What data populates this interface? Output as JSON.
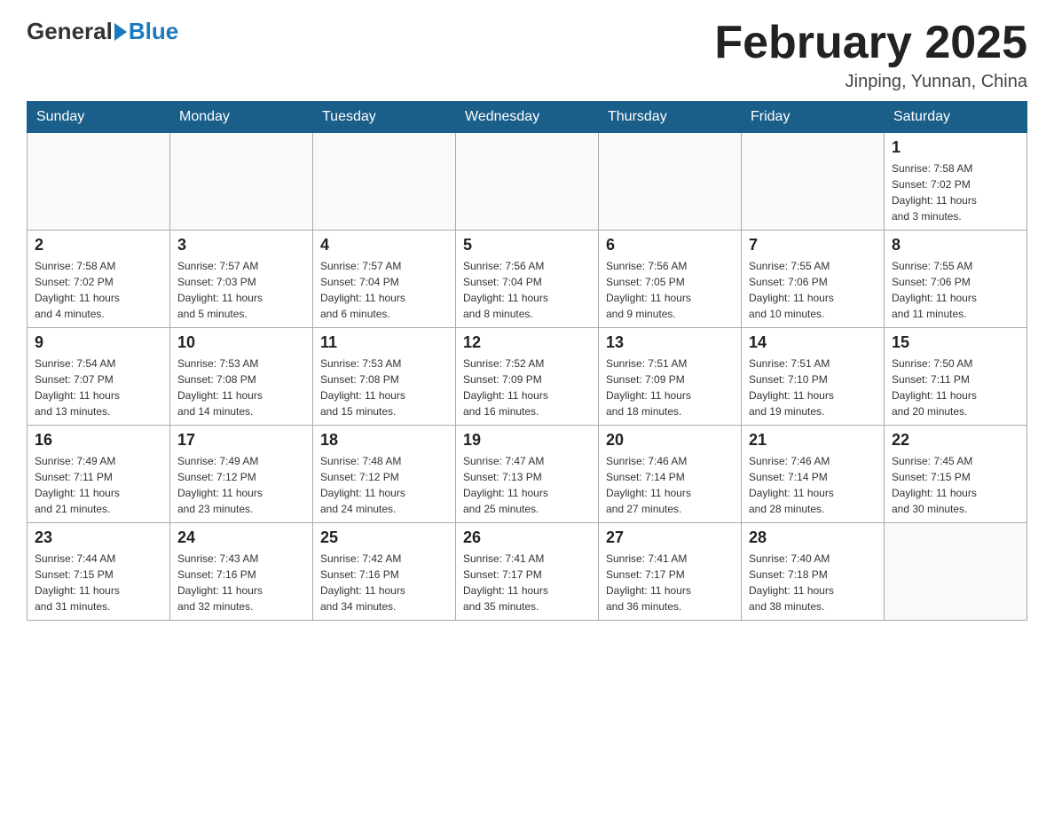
{
  "header": {
    "logo_general": "General",
    "logo_blue": "Blue",
    "month_title": "February 2025",
    "subtitle": "Jinping, Yunnan, China"
  },
  "days_of_week": [
    "Sunday",
    "Monday",
    "Tuesday",
    "Wednesday",
    "Thursday",
    "Friday",
    "Saturday"
  ],
  "weeks": [
    [
      {
        "day": "",
        "info": ""
      },
      {
        "day": "",
        "info": ""
      },
      {
        "day": "",
        "info": ""
      },
      {
        "day": "",
        "info": ""
      },
      {
        "day": "",
        "info": ""
      },
      {
        "day": "",
        "info": ""
      },
      {
        "day": "1",
        "info": "Sunrise: 7:58 AM\nSunset: 7:02 PM\nDaylight: 11 hours\nand 3 minutes."
      }
    ],
    [
      {
        "day": "2",
        "info": "Sunrise: 7:58 AM\nSunset: 7:02 PM\nDaylight: 11 hours\nand 4 minutes."
      },
      {
        "day": "3",
        "info": "Sunrise: 7:57 AM\nSunset: 7:03 PM\nDaylight: 11 hours\nand 5 minutes."
      },
      {
        "day": "4",
        "info": "Sunrise: 7:57 AM\nSunset: 7:04 PM\nDaylight: 11 hours\nand 6 minutes."
      },
      {
        "day": "5",
        "info": "Sunrise: 7:56 AM\nSunset: 7:04 PM\nDaylight: 11 hours\nand 8 minutes."
      },
      {
        "day": "6",
        "info": "Sunrise: 7:56 AM\nSunset: 7:05 PM\nDaylight: 11 hours\nand 9 minutes."
      },
      {
        "day": "7",
        "info": "Sunrise: 7:55 AM\nSunset: 7:06 PM\nDaylight: 11 hours\nand 10 minutes."
      },
      {
        "day": "8",
        "info": "Sunrise: 7:55 AM\nSunset: 7:06 PM\nDaylight: 11 hours\nand 11 minutes."
      }
    ],
    [
      {
        "day": "9",
        "info": "Sunrise: 7:54 AM\nSunset: 7:07 PM\nDaylight: 11 hours\nand 13 minutes."
      },
      {
        "day": "10",
        "info": "Sunrise: 7:53 AM\nSunset: 7:08 PM\nDaylight: 11 hours\nand 14 minutes."
      },
      {
        "day": "11",
        "info": "Sunrise: 7:53 AM\nSunset: 7:08 PM\nDaylight: 11 hours\nand 15 minutes."
      },
      {
        "day": "12",
        "info": "Sunrise: 7:52 AM\nSunset: 7:09 PM\nDaylight: 11 hours\nand 16 minutes."
      },
      {
        "day": "13",
        "info": "Sunrise: 7:51 AM\nSunset: 7:09 PM\nDaylight: 11 hours\nand 18 minutes."
      },
      {
        "day": "14",
        "info": "Sunrise: 7:51 AM\nSunset: 7:10 PM\nDaylight: 11 hours\nand 19 minutes."
      },
      {
        "day": "15",
        "info": "Sunrise: 7:50 AM\nSunset: 7:11 PM\nDaylight: 11 hours\nand 20 minutes."
      }
    ],
    [
      {
        "day": "16",
        "info": "Sunrise: 7:49 AM\nSunset: 7:11 PM\nDaylight: 11 hours\nand 21 minutes."
      },
      {
        "day": "17",
        "info": "Sunrise: 7:49 AM\nSunset: 7:12 PM\nDaylight: 11 hours\nand 23 minutes."
      },
      {
        "day": "18",
        "info": "Sunrise: 7:48 AM\nSunset: 7:12 PM\nDaylight: 11 hours\nand 24 minutes."
      },
      {
        "day": "19",
        "info": "Sunrise: 7:47 AM\nSunset: 7:13 PM\nDaylight: 11 hours\nand 25 minutes."
      },
      {
        "day": "20",
        "info": "Sunrise: 7:46 AM\nSunset: 7:14 PM\nDaylight: 11 hours\nand 27 minutes."
      },
      {
        "day": "21",
        "info": "Sunrise: 7:46 AM\nSunset: 7:14 PM\nDaylight: 11 hours\nand 28 minutes."
      },
      {
        "day": "22",
        "info": "Sunrise: 7:45 AM\nSunset: 7:15 PM\nDaylight: 11 hours\nand 30 minutes."
      }
    ],
    [
      {
        "day": "23",
        "info": "Sunrise: 7:44 AM\nSunset: 7:15 PM\nDaylight: 11 hours\nand 31 minutes."
      },
      {
        "day": "24",
        "info": "Sunrise: 7:43 AM\nSunset: 7:16 PM\nDaylight: 11 hours\nand 32 minutes."
      },
      {
        "day": "25",
        "info": "Sunrise: 7:42 AM\nSunset: 7:16 PM\nDaylight: 11 hours\nand 34 minutes."
      },
      {
        "day": "26",
        "info": "Sunrise: 7:41 AM\nSunset: 7:17 PM\nDaylight: 11 hours\nand 35 minutes."
      },
      {
        "day": "27",
        "info": "Sunrise: 7:41 AM\nSunset: 7:17 PM\nDaylight: 11 hours\nand 36 minutes."
      },
      {
        "day": "28",
        "info": "Sunrise: 7:40 AM\nSunset: 7:18 PM\nDaylight: 11 hours\nand 38 minutes."
      },
      {
        "day": "",
        "info": ""
      }
    ]
  ]
}
